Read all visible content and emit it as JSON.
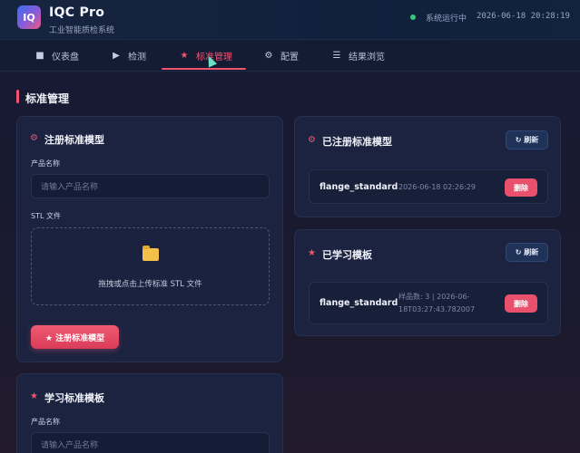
{
  "app": {
    "logo": "IQ",
    "title": "IQC Pro",
    "subtitle": "工业智能质检系统",
    "status": "系统运行中",
    "time": "2026-06-18 20:28:19"
  },
  "nav": {
    "tabs": [
      {
        "label": "仪表盘",
        "icon": "square-icon"
      },
      {
        "label": "检测",
        "icon": "play-icon"
      },
      {
        "label": "标准管理",
        "icon": "star-icon",
        "active": true
      },
      {
        "label": "配置",
        "icon": "gear-icon"
      },
      {
        "label": "结果浏览",
        "icon": "list-icon"
      }
    ]
  },
  "page": {
    "title": "标准管理"
  },
  "register_card": {
    "title": "注册标准模型",
    "product_label": "产品名称",
    "product_placeholder": "请输入产品名称",
    "stl_label": "STL 文件",
    "drop_text": "拖拽或点击上传标准 STL 文件",
    "submit_label": "★ 注册标准模型"
  },
  "registered_card": {
    "title": "已注册标准模型",
    "refresh_label": "↻ 刷新",
    "items": [
      {
        "name": "flange_standard",
        "meta": "2026-06-18 02:26:29",
        "delete_label": "删除"
      }
    ]
  },
  "learned_card": {
    "title": "已学习模板",
    "refresh_label": "↻ 刷新",
    "items": [
      {
        "name": "flange_standard",
        "meta_line1": "样品数: 3 | 2026-06-",
        "meta_line2": "18T03:27:43.782007",
        "delete_label": "删除"
      }
    ]
  },
  "learn_card": {
    "title": "学习标准模板",
    "product_label": "产品名称",
    "product_placeholder": "请输入产品名称"
  },
  "colors": {
    "accent": "#ef5470",
    "status_ok": "#34c77b",
    "folder": "#f2c04b"
  }
}
